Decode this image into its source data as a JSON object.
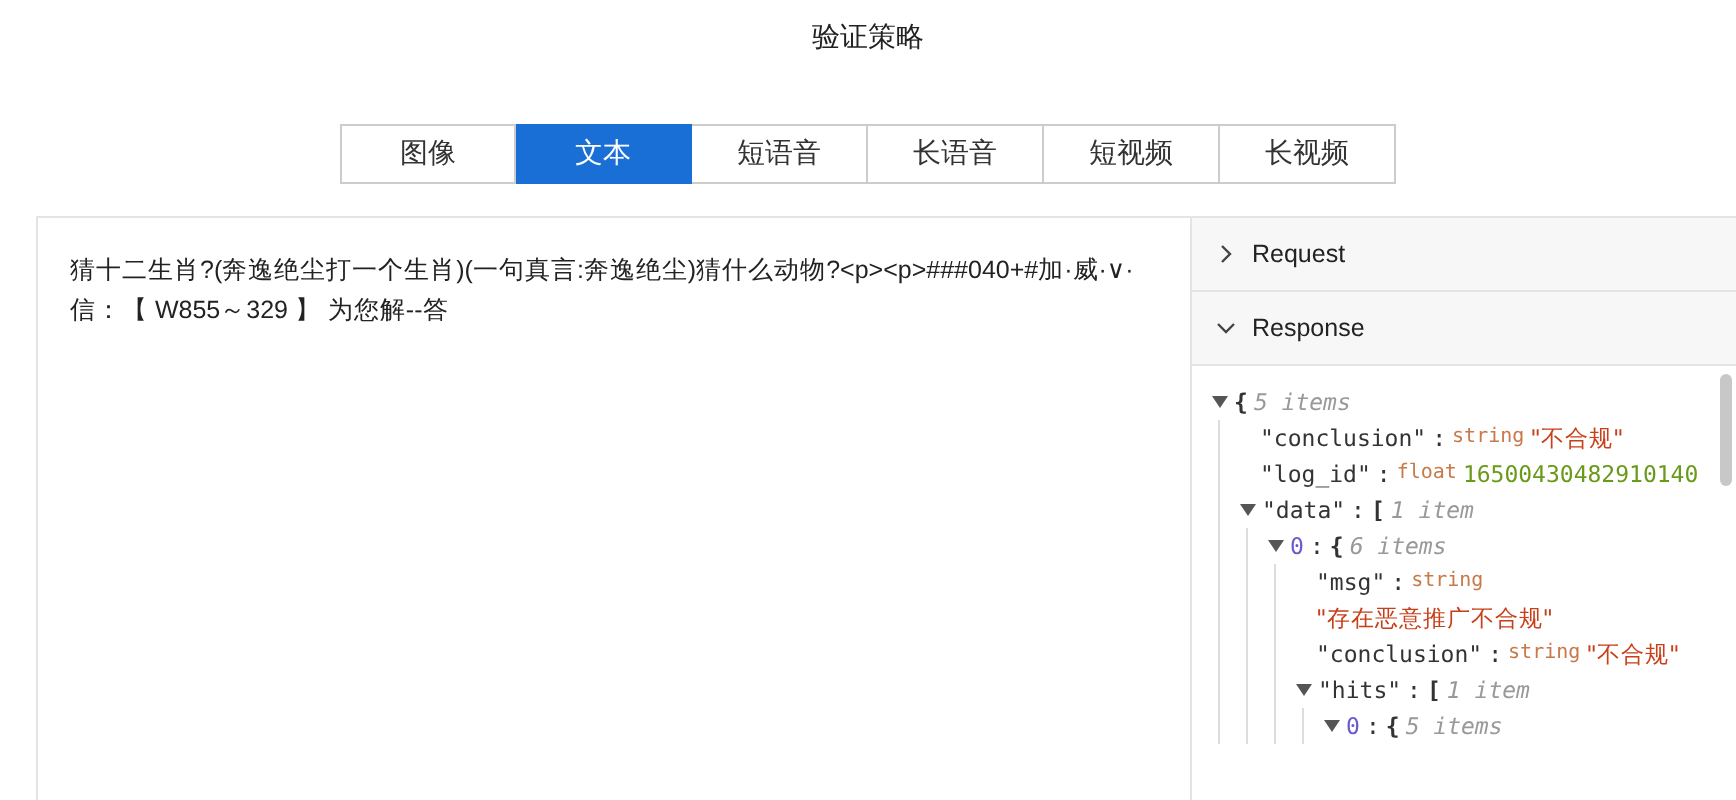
{
  "title": "验证策略",
  "tabs": [
    {
      "label": "图像",
      "selected": false
    },
    {
      "label": "文本",
      "selected": true
    },
    {
      "label": "短语音",
      "selected": false
    },
    {
      "label": "长语音",
      "selected": false
    },
    {
      "label": "短视频",
      "selected": false
    },
    {
      "label": "长视频",
      "selected": false
    }
  ],
  "input_text": "猜十二生肖?(奔逸绝尘打一个生肖)(一句真言:奔逸绝尘)猜什么动物?<p><p>###040+#加·威·∨·信：【 W855～329 】 为您解--答",
  "sections": [
    {
      "label": "Request",
      "expanded": false
    },
    {
      "label": "Response",
      "expanded": true
    }
  ],
  "response_tree": {
    "bracket": "{",
    "count": "5 items",
    "expanded": true,
    "children": [
      {
        "key": "\"conclusion\"",
        "colon": ":",
        "type": "string",
        "value": "\"不合规\""
      },
      {
        "key": "\"log_id\"",
        "colon": ":",
        "type": "float",
        "value": "16500430482910140"
      },
      {
        "key": "\"data\"",
        "colon": ":",
        "bracket": "[",
        "count": "1 item",
        "expanded": true,
        "children": [
          {
            "key": "0",
            "colon": ":",
            "bracket": "{",
            "count": "6 items",
            "expanded": true,
            "children": [
              {
                "key": "\"msg\"",
                "colon": ":",
                "type": "string",
                "value": "\"存在恶意推广不合规\""
              },
              {
                "key": "\"conclusion\"",
                "colon": ":",
                "type": "string",
                "value": "\"不合规\""
              },
              {
                "key": "\"hits\"",
                "colon": ":",
                "bracket": "[",
                "count": "1 item",
                "expanded": true,
                "children": [
                  {
                    "key": "0",
                    "colon": ":",
                    "bracket": "{",
                    "count": "5 items",
                    "expanded": true
                  }
                ]
              }
            ]
          }
        ]
      }
    ]
  }
}
